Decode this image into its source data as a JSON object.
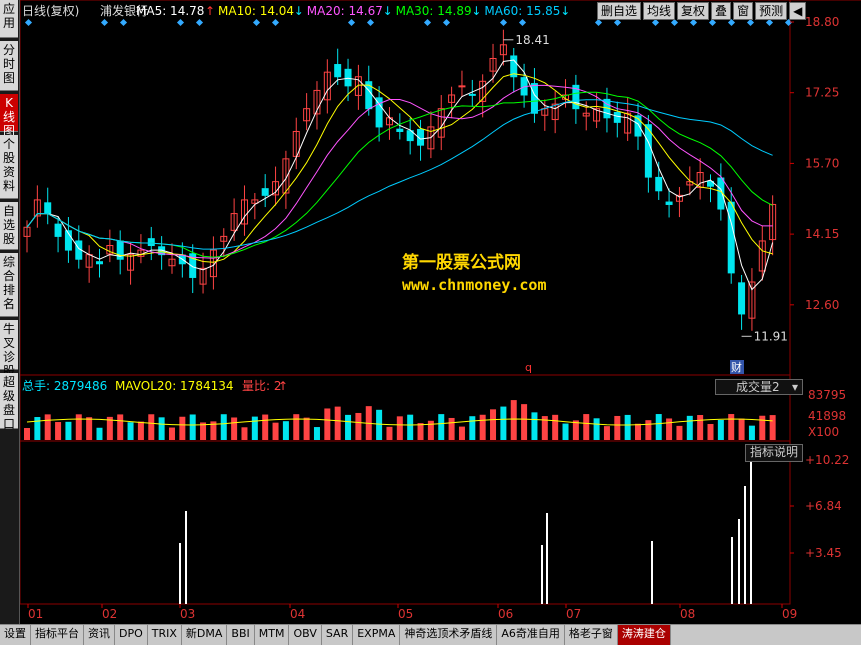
{
  "sidebar": {
    "tabs": [
      {
        "label": "应用",
        "active": false
      },
      {
        "label": "分时图",
        "active": false
      },
      {
        "label": "K线图",
        "active": true
      },
      {
        "label": "个股资料",
        "active": false
      },
      {
        "label": "自选股",
        "active": false
      },
      {
        "label": "综合排名",
        "active": false
      },
      {
        "label": "牛叉诊股",
        "active": false
      },
      {
        "label": "超级盘口",
        "active": false
      }
    ]
  },
  "header": {
    "chart_type": "日线(复权)",
    "stock_name": "浦发银行",
    "ma": [
      {
        "label": "MA5: 14.78",
        "arrow": "↑",
        "color": "#ffffff"
      },
      {
        "label": "MA10: 14.04",
        "arrow": "↓",
        "color": "#ffff00"
      },
      {
        "label": "MA20: 14.67",
        "arrow": "↓",
        "color": "#ff55ff"
      },
      {
        "label": "MA30: 14.89",
        "arrow": "↓",
        "color": "#00ff00"
      },
      {
        "label": "MA60: 15.85",
        "arrow": "↓",
        "color": "#00ccff"
      }
    ]
  },
  "toolbar": {
    "buttons": [
      "删自选",
      "均线",
      "复权",
      "叠",
      "窗",
      "预测"
    ]
  },
  "price_axis": [
    "18.80",
    "17.25",
    "15.70",
    "14.15",
    "12.60"
  ],
  "annotations": {
    "high": "18.41",
    "low": "11.91",
    "marker_q": "q",
    "marker_cai": "财"
  },
  "watermark": {
    "line1": "第一股票公式网",
    "line2": "www.chnmoney.com"
  },
  "volume": {
    "total_label": "总手: 2879486",
    "mavol_label": "MAVOL20: 1784134",
    "ratio_label": "量比: 2",
    "axis": [
      "83795",
      "41898",
      "X100"
    ],
    "selector": "成交量2"
  },
  "indicator": {
    "button": "指标说明",
    "axis": [
      "+10.22",
      "+6.84",
      "+3.45"
    ]
  },
  "x_axis": [
    "01",
    "02",
    "03",
    "04",
    "05",
    "06",
    "07",
    "08",
    "09"
  ],
  "bottom_tabs": [
    {
      "label": "设置",
      "active": false
    },
    {
      "label": "指标平台",
      "active": false
    },
    {
      "label": "资讯",
      "active": false
    },
    {
      "label": "DPO",
      "active": false
    },
    {
      "label": "TRIX",
      "active": false
    },
    {
      "label": "新DMA",
      "active": false
    },
    {
      "label": "BBI",
      "active": false
    },
    {
      "label": "MTM",
      "active": false
    },
    {
      "label": "OBV",
      "active": false
    },
    {
      "label": "SAR",
      "active": false
    },
    {
      "label": "EXPMA",
      "active": false
    },
    {
      "label": "神奇选顶术矛盾线",
      "active": false
    },
    {
      "label": "A6奇准自用",
      "active": false
    },
    {
      "label": "格老子窗",
      "active": false
    },
    {
      "label": "涛涛建仓",
      "active": true
    }
  ],
  "chart_data": {
    "type": "candlestick",
    "price_range": [
      11.5,
      18.8
    ],
    "description_points": {
      "close": [
        14.3,
        14.9,
        14.6,
        14.1,
        13.8,
        13.6,
        13.7,
        13.5,
        13.9,
        13.6,
        13.7,
        13.8,
        13.9,
        13.7,
        13.6,
        13.5,
        13.2,
        13.4,
        13.8,
        14.1,
        14.6,
        14.9,
        14.9,
        15.0,
        15.3,
        15.8,
        16.4,
        16.9,
        17.3,
        17.7,
        17.6,
        17.4,
        17.6,
        16.9,
        16.5,
        16.7,
        16.4,
        16.2,
        16.1,
        16.5,
        16.9,
        17.2,
        17.4,
        17.2,
        17.5,
        18.0,
        18.3,
        17.6,
        17.2,
        16.8,
        16.9,
        17.0,
        17.2,
        16.9,
        16.8,
        16.9,
        16.7,
        16.6,
        16.8,
        16.3,
        15.4,
        15.1,
        14.8,
        15.0,
        15.3,
        15.5,
        15.2,
        14.7,
        13.3,
        12.4,
        13.1,
        14.0,
        14.8
      ],
      "ma5_last": 14.78,
      "ma10_last": 14.04,
      "ma20_last": 14.67,
      "ma30_last": 14.89,
      "ma60_last": 15.85
    }
  }
}
